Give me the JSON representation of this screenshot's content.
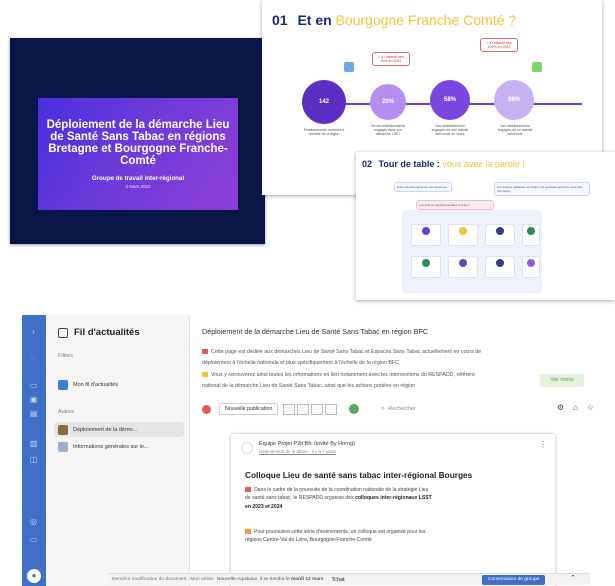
{
  "slide1": {
    "title": "Déploiement de la démarche Lieu de Santé Sans Tabac en régions Bretagne et Bourgogne Franche-Comté",
    "subtitle": "Groupe de travail inter-régional",
    "date": "2 Mars 2023"
  },
  "slide2": {
    "number": "01",
    "title_prefix": "Et en",
    "title_highlight": "Bourgogne Franche Comté ?",
    "bubble1": "≈ à l'objectif des 50% en 2022",
    "bubble2": "≈ à l'objectif des 100% en 2023",
    "stats": [
      {
        "value": "142",
        "caption": "Etablissements recensés à l'échelle de la région"
      },
      {
        "value": "20%",
        "caption": "De ces établissements engagés dans une démarche LSST"
      },
      {
        "value": "58%",
        "caption": "Des établissements engagés ont une activité autonome en cours"
      },
      {
        "value": "98%",
        "caption": "Des établissements engagés ont un activité autonome"
      }
    ]
  },
  "slide3": {
    "number": "02",
    "title_prefix": "Tour de table :",
    "title_highlight": "vous avez la parole !",
    "tag1": "Entre départements de vos structures",
    "tag2": "Les actions réalisées, les freins, les réussites pourront vous être interrogés",
    "tag3": "Les actions départementales et d'où ?"
  },
  "leftpane": {
    "title": "Fil d'actualités",
    "section1": "Filtres",
    "item_filter": "Mon fil d'actualités",
    "section2": "Autres",
    "item_selected": "Déploiement de la démo...",
    "item_other": "Informations générales sur le..."
  },
  "content": {
    "title": "Déploiement de la démarche Lieu de Santé Sans Tabac en région BFC",
    "line1": "Cette page est dédiée aux démarches Lieu de Santé Sans Tabac et Espaces Sans Tabac actuellement en cours de",
    "line2": "déploiement à l'échelle nationale et plus spécifiquement à l'échelle de la région BFC",
    "line3": "Vous y retrouverez ainsi toutes les informations en lien notamment avec les interventions du RESPADD, référent",
    "line4": "national de la démarche Lieu de Santé Sans Tabac, ainsi que les actions portées en région",
    "voir_plus": "Voir moins",
    "new_post": "Nouvelle publication",
    "search_placeholder": "Rechercher"
  },
  "post": {
    "author": "Equipe Projet P2it Bfc (invité By Horng)",
    "meta": "Déploiement de la démo · il y a 7 jours",
    "title": "Colloque Lieu de santé sans tabac inter-régional Bourges",
    "p1a": "Dans le cadre de la poursuite de la coordination nationale de la stratégie Lieu",
    "p1b": "de santé sans tabac, le RESPADD organise des",
    "p1b_bold": "colloques inter-régionaux LSST",
    "p1c": "en 2023 et 2024",
    "p2a": "Pour poursuivre cette série d'événements, un colloque est organisé pour les",
    "p2b": "régions Centre-Val de Loire, Bourgogne-Franche-Comté",
    "p2c": "Nouvelle-Aquitaine. Il se tiendra le",
    "p2c_bold": "mardi 12 mars"
  },
  "statusbar": {
    "left": "Dernière modification du document : Mon article",
    "chat": "Tchat",
    "conversation": "Conversation de groupe"
  },
  "colors": {
    "teams_rail": "#3f6fc7",
    "slide_navy": "#0b1648",
    "accent_yellow": "#f3c23a",
    "purple": "#6b3bd9"
  }
}
